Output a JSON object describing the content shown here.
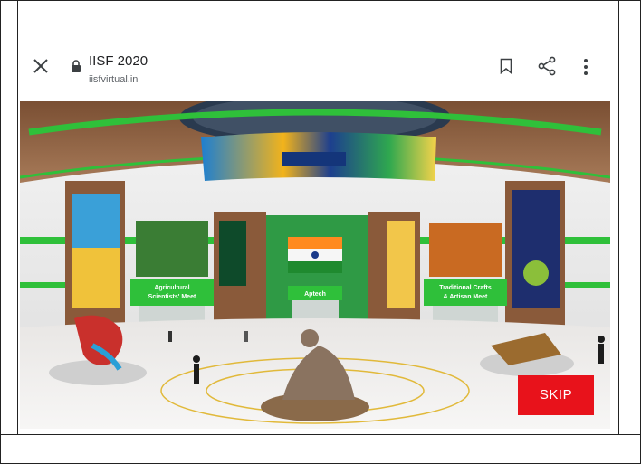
{
  "browser": {
    "title": "IISF 2020",
    "url": "iisfvirtual.in",
    "icons": [
      "close-icon",
      "lock-icon",
      "bookmark-icon",
      "share-icon",
      "more-vert-icon"
    ]
  },
  "scene": {
    "booths": [
      {
        "label_line1": "Agricultural",
        "label_line2": "Scientists' Meet"
      },
      {
        "label_line1": "Aptech",
        "label_line2": ""
      },
      {
        "label_line1": "Traditional Crafts",
        "label_line2": "& Artisan Meet"
      }
    ]
  },
  "skip_button": {
    "label": "SKIP"
  },
  "colors": {
    "skip": "#e8121b",
    "accent_green": "#2fc03a",
    "wood": "#8a5a3a"
  }
}
